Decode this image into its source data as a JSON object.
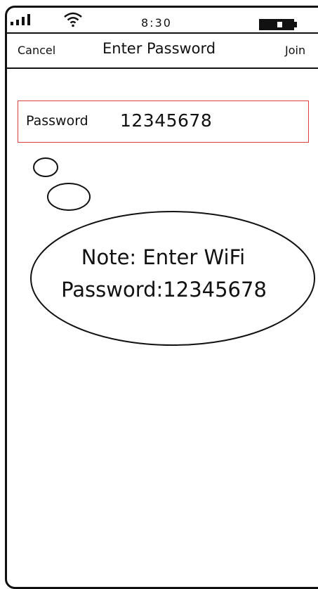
{
  "status_bar": {
    "time": "8:30",
    "signal_icon": "cellular-signal-icon",
    "wifi_icon": "wifi-icon",
    "battery_icon": "battery-icon"
  },
  "nav_bar": {
    "cancel_label": "Cancel",
    "title": "Enter Password",
    "join_label": "Join"
  },
  "password_field": {
    "label": "Password",
    "value": "12345678",
    "border_color": "#d94040"
  },
  "note_bubble": {
    "line1": "Note: Enter WiFi",
    "line2": "Password:12345678"
  }
}
